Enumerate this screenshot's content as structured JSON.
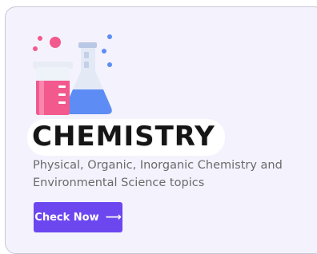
{
  "card": {
    "title": "CHEMISTRY",
    "description": "Physical, Organic, Inorganic Chemistry and Environmental Science topics",
    "cta_label": "Check Now",
    "cta_icon": "arrow-right-icon"
  },
  "colors": {
    "card_background": "#f4f2fd",
    "button": "#6c47f0",
    "beaker_liquid": "#f25a8e",
    "flask_liquid": "#5d8cf4"
  }
}
